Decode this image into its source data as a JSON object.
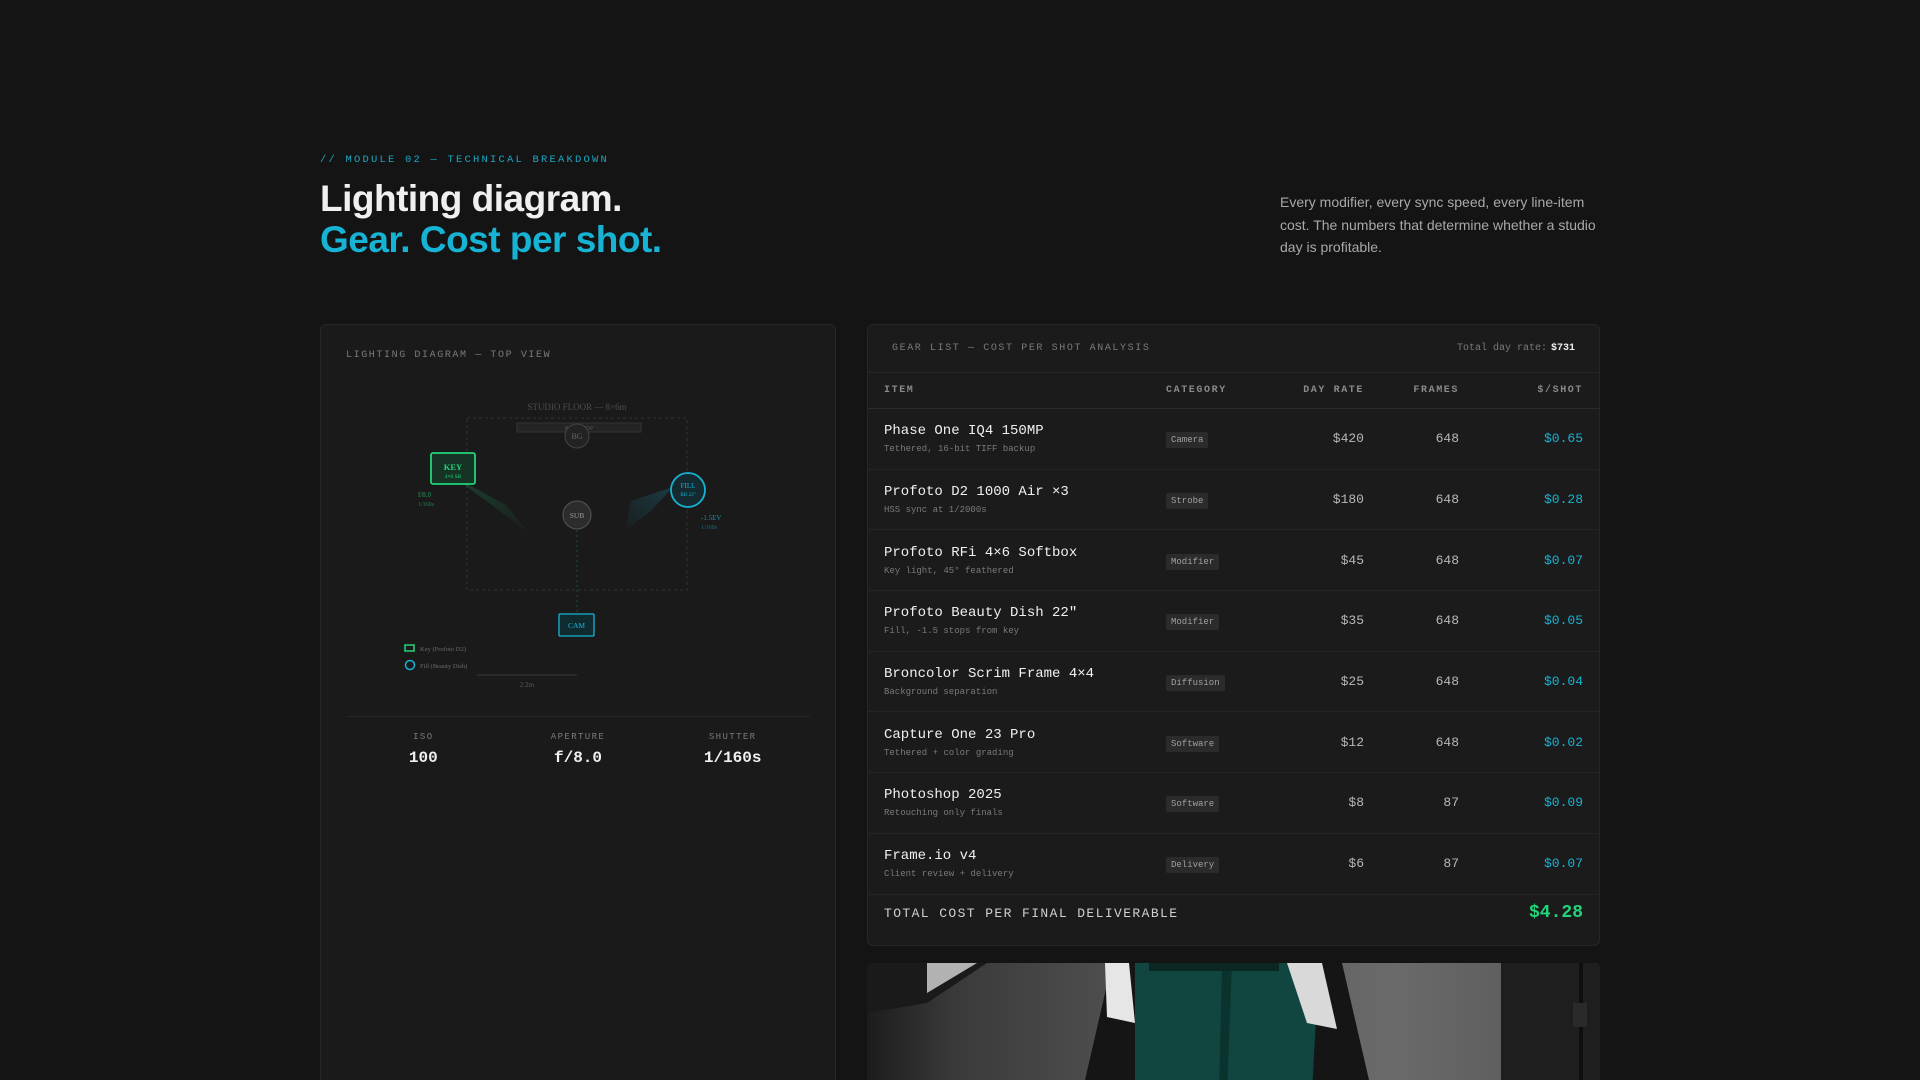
{
  "header": {
    "eyebrow": "// MODULE 02 — TECHNICAL BREAKDOWN",
    "title_line1": "Lighting diagram.",
    "title_line2": "Gear. Cost per shot.",
    "intro": "Every modifier, every sync speed, every line-item cost. The numbers that determine whether a studio day is profitable."
  },
  "lighting": {
    "label": "LIGHTING DIAGRAM — TOP VIEW",
    "floor_label": "STUDIO FLOOR — 8×6m",
    "backdrop_label": "BACKDROP",
    "bg_label": "BG",
    "key": {
      "label": "KEY",
      "sub": "4×6 SB",
      "readout1": "f/8.0",
      "readout2": "1/160s"
    },
    "fill": {
      "label": "FILL",
      "sub": "BD 22\"",
      "readout1": "-1.5EV",
      "readout2": "1/160s"
    },
    "subject_label": "SUB",
    "camera_label": "CAM",
    "legend": [
      {
        "label": "Key (Profoto D2)",
        "shape": "rect",
        "color": "#22d47a"
      },
      {
        "label": "Fill (Beauty Dish)",
        "shape": "circle",
        "color": "#17b3d4"
      }
    ],
    "distance_label": "2.2m",
    "exif": [
      {
        "label": "ISO",
        "value": "100"
      },
      {
        "label": "APERTURE",
        "value": "f/8.0"
      },
      {
        "label": "SHUTTER",
        "value": "1/160s"
      }
    ]
  },
  "gear": {
    "label": "GEAR LIST — COST PER SHOT ANALYSIS",
    "total_rate_label": "Total day rate:",
    "total_rate_value": "$731",
    "columns": [
      "ITEM",
      "CATEGORY",
      "DAY RATE",
      "FRAMES",
      "$/SHOT"
    ],
    "rows": [
      {
        "name": "Phase One IQ4 150MP",
        "sub": "Tethered, 16-bit TIFF backup",
        "category": "Camera",
        "rate": "$420",
        "frames": "648",
        "per_shot": "$0.65"
      },
      {
        "name": "Profoto D2 1000 Air ×3",
        "sub": "HSS sync at 1/2000s",
        "category": "Strobe",
        "rate": "$180",
        "frames": "648",
        "per_shot": "$0.28"
      },
      {
        "name": "Profoto RFi 4×6 Softbox",
        "sub": "Key light, 45° feathered",
        "category": "Modifier",
        "rate": "$45",
        "frames": "648",
        "per_shot": "$0.07"
      },
      {
        "name": "Profoto Beauty Dish 22\"",
        "sub": "Fill, -1.5 stops from key",
        "category": "Modifier",
        "rate": "$35",
        "frames": "648",
        "per_shot": "$0.05"
      },
      {
        "name": "Broncolor Scrim Frame 4×4",
        "sub": "Background separation",
        "category": "Diffusion",
        "rate": "$25",
        "frames": "648",
        "per_shot": "$0.04"
      },
      {
        "name": "Capture One 23 Pro",
        "sub": "Tethered + color grading",
        "category": "Software",
        "rate": "$12",
        "frames": "648",
        "per_shot": "$0.02"
      },
      {
        "name": "Photoshop 2025",
        "sub": "Retouching only finals",
        "category": "Software",
        "rate": "$8",
        "frames": "87",
        "per_shot": "$0.09"
      },
      {
        "name": "Frame.io v4",
        "sub": "Client review + delivery",
        "category": "Delivery",
        "rate": "$6",
        "frames": "87",
        "per_shot": "$0.07"
      }
    ],
    "footer_label": "TOTAL COST PER FINAL DELIVERABLE",
    "footer_value": "$4.28"
  },
  "colors": {
    "accent": "#17b3d4",
    "key_green": "#22d47a",
    "background": "#141414"
  }
}
